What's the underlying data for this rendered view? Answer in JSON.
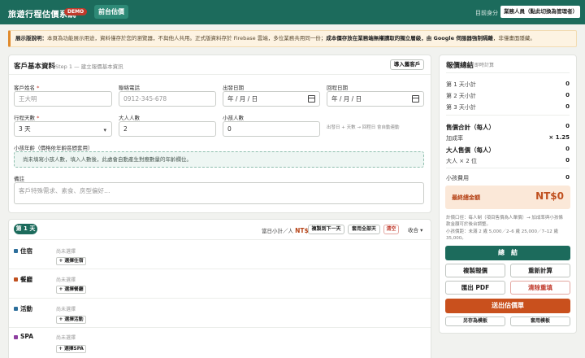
{
  "header": {
    "brand": "旅遊行程估價系統",
    "badge": "DEMO",
    "tab": "前台估價",
    "role_label": "目前身分",
    "role_value": "業務人員（點此切換為管理者）"
  },
  "notice": {
    "lead": "展示版說明：",
    "text": "本頁為功能展示用途，資料僅存於您的瀏覽器，不與他人共用。正式版資料存於 Firebase 雲端，多位業務共用同一份；",
    "emphasis": "成本價存放在業務端無權讀取的獨立層級，由 Google 伺服器強制隔離",
    "tail": "，非僅畫面隱藏。"
  },
  "customer": {
    "title": "客戶基本資料",
    "subtitle": "Step 1 — 建立報價基本資訊",
    "import_button": "導入舊客戶",
    "name_label": "客戶姓名",
    "name_placeholder": "王大明",
    "phone_label": "聯絡電話",
    "phone_placeholder": "0912-345-678",
    "depart_label": "出發日期",
    "return_label": "回程日期",
    "date_placeholder": "年 / 月 / 日",
    "days_label": "行程天數",
    "days_value": "3 天",
    "adults_label": "大人人數",
    "adults_value": "2",
    "kids_label": "小孩人數",
    "kids_value": "0",
    "date_hint": "出發日 + 天數 → 回程日 會自動連動",
    "kids_age_label": "小孩年齡（價格依年齡區間套用）",
    "kids_age_hint": "尚未填寫小孩人數，填入人數後，此處會自動產生對應數量的年齡欄位。",
    "notes_label": "備註",
    "notes_placeholder": "客戶特殊需求、素食、房型偏好…",
    "required_mark": "*"
  },
  "day": {
    "badge": "第 1 天",
    "subtotal_label": "當日小計／人",
    "subtotal_value": "NT$0",
    "copy_next": "複製到下一天",
    "apply_all": "套用全部天",
    "clear": "清空",
    "collapse": "收合 ▾",
    "categories": [
      {
        "name": "住宿",
        "none": "尚未選擇",
        "button": "+ 選擇住宿",
        "color": "#2c6e9b"
      },
      {
        "name": "餐廳",
        "none": "尚未選擇",
        "button": "+ 選擇餐廳",
        "color": "#c0501f"
      },
      {
        "name": "活動",
        "none": "尚未選擇",
        "button": "+ 選擇活動",
        "color": "#2c6e9b"
      },
      {
        "name": "SPA",
        "none": "尚未選擇",
        "button": "+ 選擇SPA",
        "color": "#8e3fa0"
      }
    ]
  },
  "summary": {
    "title": "報價總結",
    "subtitle": "即時計算",
    "day1": "第 1 天小計",
    "day1_val": "0",
    "day2": "第 2 天小計",
    "day2_val": "0",
    "day3": "第 3 天小計",
    "day3_val": "0",
    "sale_total": "售價合計（每人）",
    "sale_total_val": "0",
    "markup": "加成率",
    "markup_val": "× 1.25",
    "adult_price": "大人售價（每人）",
    "adult_price_val": "0",
    "adult_count": "大人 × 2 位",
    "adult_count_val": "0",
    "kids_fee": "小孩費用",
    "kids_fee_val": "0",
    "final_label": "最終總金額",
    "final_value": "NT$0",
    "fine1": "計價口徑：每人制（項目售價為人單價）→ 加成率與小孩條",
    "fine2": "款金額可於後台調整。",
    "fine3": "小孩價距：未滿 2 歲 5,000／2–6 歲 25,000／7–12 歲",
    "fine4": "35,000。",
    "btn_total": "總　結",
    "btn_copy": "複製報價",
    "btn_recalc": "重新計算",
    "btn_pdf": "匯出 PDF",
    "btn_clear": "清除重填",
    "btn_submit": "送出估價單",
    "btn_save_tpl": "另存為模板",
    "btn_apply_tpl": "套用模板"
  }
}
